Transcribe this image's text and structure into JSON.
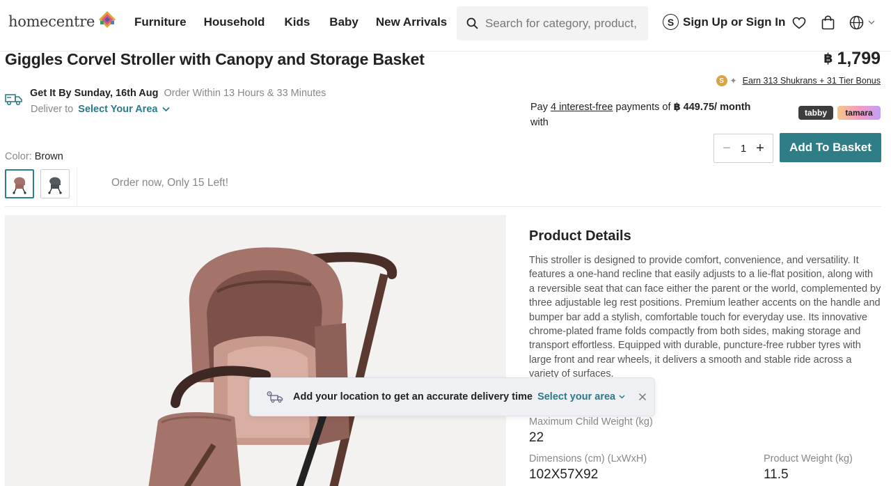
{
  "header": {
    "logo_text": "homecentre",
    "nav": [
      "Furniture",
      "Household",
      "Kids",
      "Baby",
      "New Arrivals"
    ],
    "search_placeholder": "Search for category, product, brand...",
    "signin_label": "Sign Up or Sign In",
    "signin_icon": "S"
  },
  "product": {
    "title": "Giggles Corvel Stroller with Canopy and Storage Basket",
    "currency_symbol": "฿",
    "price": "1,799",
    "shukrans": {
      "coin": "S",
      "sparkle": "✦",
      "earn_text": "Earn 313 Shukrans + 31  Tier Bonus"
    },
    "delivery": {
      "get_it": "Get It By Sunday, 16th Aug",
      "order_within": "Order Within 13 Hours & 33 Minutes",
      "deliver_to": "Deliver to",
      "select_area": "Select Your Area"
    },
    "installments": {
      "pay": "Pay",
      "count": "4 interest-free",
      "payments_of": "payments of",
      "amount": "฿ 449.75/ month",
      "with": "with",
      "providers": [
        "tabby",
        "tamara"
      ]
    },
    "quantity": {
      "minus": "−",
      "value": "1",
      "plus": "+"
    },
    "add_to_basket": "Add To Basket",
    "color": {
      "label": "Color:",
      "value": "Brown"
    },
    "stock_message": "Order now, Only 15 Left!"
  },
  "details": {
    "title": "Product Details",
    "description": "This stroller is designed to provide comfort, convenience, and versatility. It features a one-hand recline that easily adjusts to a lie-flat position, along with a reversible seat that can face either the parent or the world, complemented by three adjustable leg rest positions. Premium leather accents on the handle and bumper bar add a stylish, comfortable touch for everyday use. Its innovative chrome-plated frame folds compactly from both sides, making storage and transport effortless. Equipped with durable, puncture-free rubber tyres with large front and rear wheels, it delivers a smooth and stable ride across a variety of surfaces.",
    "specs": [
      {
        "label": "Maximum Child Weight (kg)",
        "value": "22"
      },
      {
        "label": "Dimensions (cm) (LxWxH)",
        "value": "102X57X92"
      },
      {
        "label": "Product Weight (kg)",
        "value": "11.5"
      }
    ]
  },
  "toast": {
    "text": "Add your location to get an accurate delivery time",
    "link": "Select your area"
  },
  "colors": {
    "accent": "#2e7d87",
    "link": "#2b7a8c",
    "stroller_brown": "#a4746a"
  }
}
